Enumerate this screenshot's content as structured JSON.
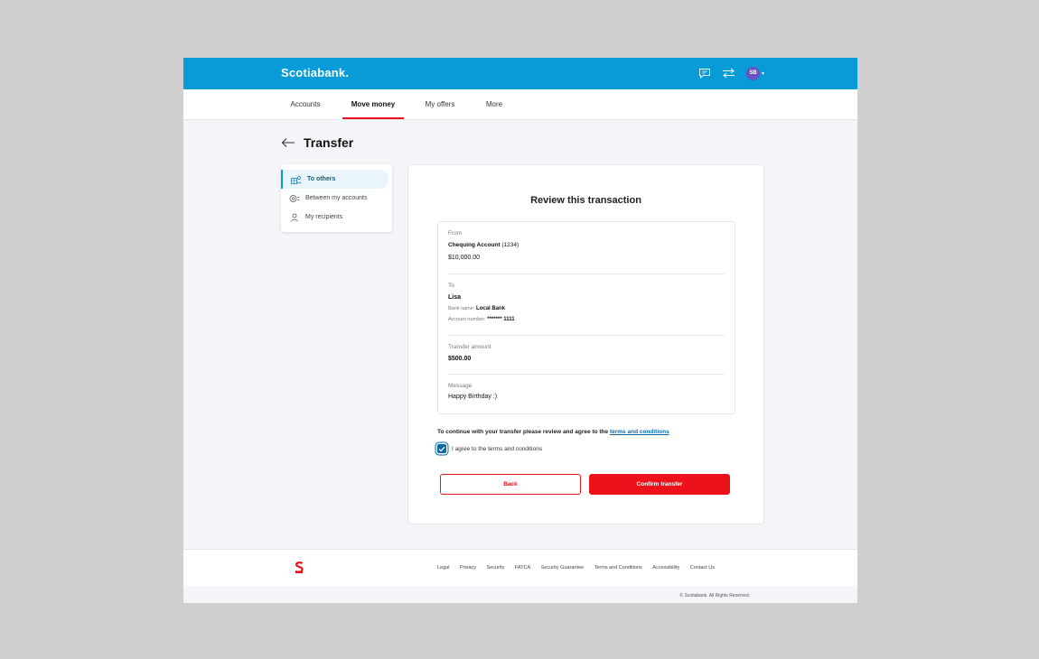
{
  "header": {
    "logo": "Scotiabank.",
    "avatar_initials": "SB",
    "icons": [
      "chat-icon",
      "transfer-arrows-icon",
      "chevron-down-icon"
    ],
    "brand_color": "#079bd8",
    "accent_color": "#ec111a"
  },
  "nav": {
    "tabs": [
      {
        "label": "Accounts"
      },
      {
        "label": "Move money"
      },
      {
        "label": "My offers"
      },
      {
        "label": "More"
      }
    ],
    "active": "Move money"
  },
  "page": {
    "title": "Transfer"
  },
  "side_menu": {
    "items": [
      {
        "label": "To others",
        "icon": "gift-person-icon"
      },
      {
        "label": "Between my accounts",
        "icon": "accounts-transfer-icon"
      },
      {
        "label": "My recipients",
        "icon": "person-icon"
      }
    ],
    "active": "To others"
  },
  "review": {
    "title": "Review this transaction",
    "from": {
      "label": "From",
      "account_name": "Chequing Account",
      "account_number": "(1234)",
      "balance": "$10,000.00"
    },
    "to": {
      "label": "To",
      "name": "Lisa",
      "bank_label": "Bank name:",
      "bank_name": "Local Bank",
      "account_label": "Account number:",
      "account_number": "******* 1111"
    },
    "amount": {
      "label": "Transfer amount",
      "value": "$500.00"
    },
    "message": {
      "label": "Message",
      "value": "Happy Birthday :)"
    },
    "terms_text": "To continue with your transfer please review and agree to the",
    "terms_link": "terms and conditions",
    "checkbox_label": "I agree to the terms and conditions",
    "checkbox_checked": true,
    "back_label": "Back",
    "confirm_label": "Confirm transfer"
  },
  "footer": {
    "links": [
      "Legal",
      "Privacy",
      "Security",
      "FATCA",
      "Security Guarantee",
      "Terms and Conditions",
      "Accessibility",
      "Contact Us"
    ],
    "copyright": "© Scotiabank. All Rights Reserved."
  }
}
